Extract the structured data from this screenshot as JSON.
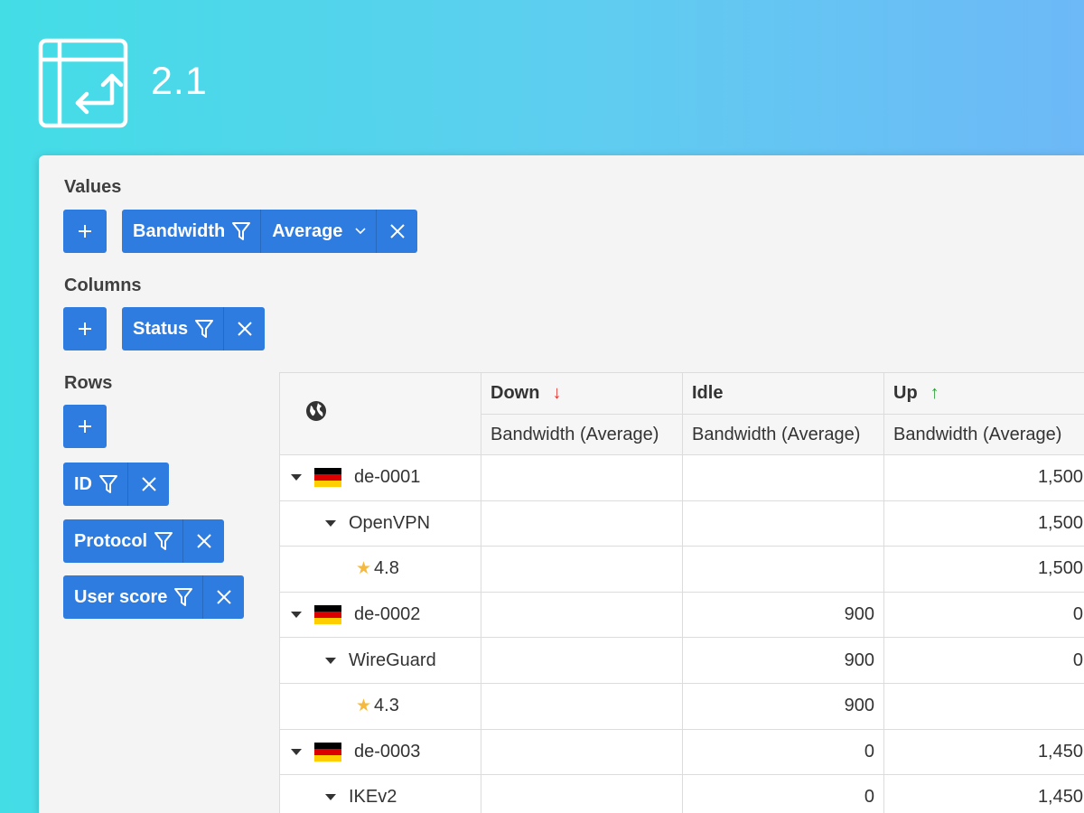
{
  "header": {
    "version": "2.1"
  },
  "values": {
    "label": "Values",
    "field": "Bandwidth",
    "aggregation": "Average"
  },
  "columns": {
    "label": "Columns",
    "field": "Status"
  },
  "rows": {
    "label": "Rows",
    "fields": [
      "ID",
      "Protocol",
      "User score"
    ]
  },
  "grid": {
    "statuses": [
      {
        "name": "Down",
        "arrow": "↓",
        "color": "#e53935"
      },
      {
        "name": "Idle",
        "arrow": "",
        "color": ""
      },
      {
        "name": "Up",
        "arrow": "↑",
        "color": "#2e9e3a"
      }
    ],
    "measure": "Bandwidth (Average)",
    "rows": [
      {
        "level": 0,
        "label": "de-0001",
        "down": "",
        "idle": "",
        "up": "1,500"
      },
      {
        "level": 1,
        "label": "OpenVPN",
        "down": "",
        "idle": "",
        "up": "1,500"
      },
      {
        "level": 2,
        "label": "4.8",
        "down": "",
        "idle": "",
        "up": "1,500"
      },
      {
        "level": 0,
        "label": "de-0002",
        "down": "",
        "idle": "900",
        "up": "0"
      },
      {
        "level": 1,
        "label": "WireGuard",
        "down": "",
        "idle": "900",
        "up": "0"
      },
      {
        "level": 2,
        "label": "4.3",
        "down": "",
        "idle": "900",
        "up": ""
      },
      {
        "level": 0,
        "label": "de-0003",
        "down": "",
        "idle": "0",
        "up": "1,450"
      },
      {
        "level": 1,
        "label": "IKEv2",
        "down": "",
        "idle": "0",
        "up": "1,450"
      }
    ]
  },
  "icons": {
    "hero": "pivot-table-icon",
    "add": "plus-icon",
    "filter": "filter-icon",
    "remove": "close-icon",
    "dropdown": "chevron-down-icon",
    "corner": "globe-icon",
    "flag": "germany-flag-icon",
    "score": "star-icon"
  },
  "colors": {
    "accent": "#2e7ce0",
    "star": "#f6b93b"
  }
}
